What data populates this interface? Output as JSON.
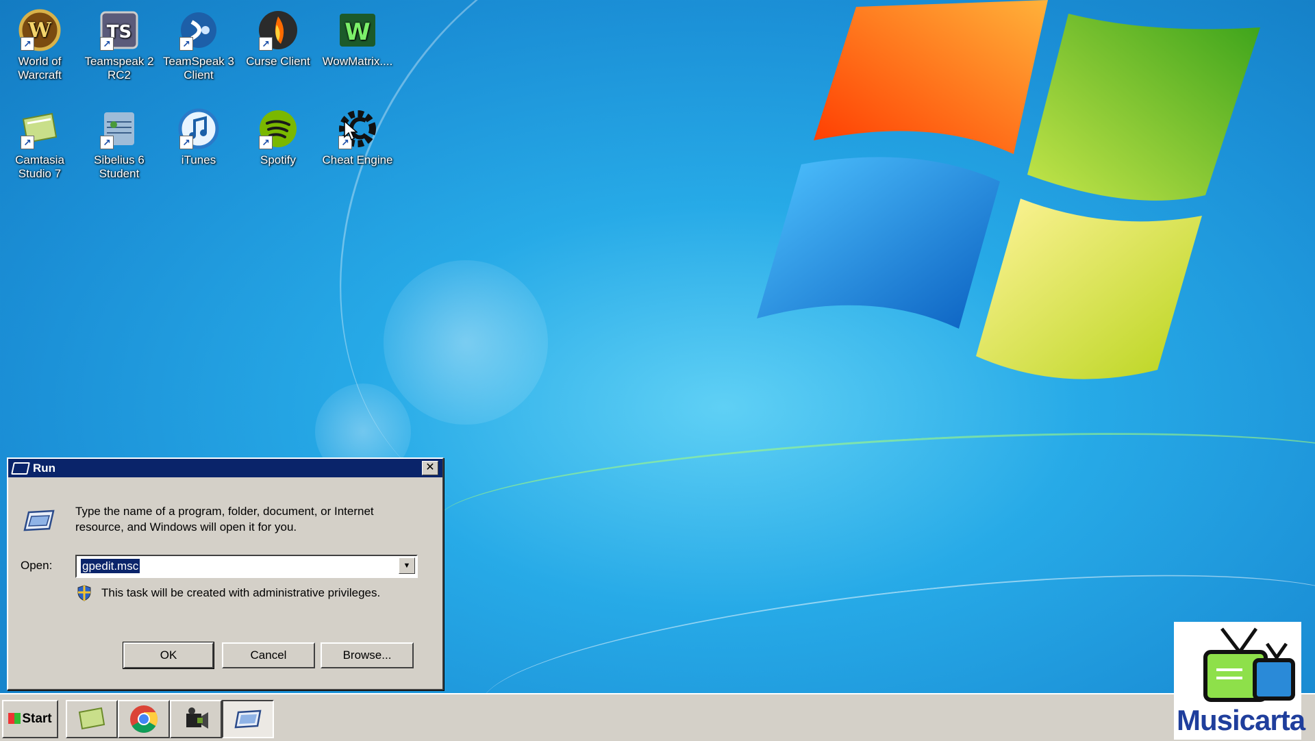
{
  "desktop_icons": [
    {
      "label": "World of Warcraft",
      "icon": "world-of-warcraft-icon"
    },
    {
      "label": "Teamspeak 2 RC2",
      "icon": "teamspeak-2-icon"
    },
    {
      "label": "TeamSpeak 3 Client",
      "icon": "teamspeak-3-icon"
    },
    {
      "label": "Curse Client",
      "icon": "curse-client-icon"
    },
    {
      "label": "WowMatrix....",
      "icon": "wowmatrix-icon"
    },
    {
      "label": "Camtasia Studio 7",
      "icon": "camtasia-icon"
    },
    {
      "label": "Sibelius 6 Student",
      "icon": "sibelius-icon"
    },
    {
      "label": "iTunes",
      "icon": "itunes-icon"
    },
    {
      "label": "Spotify",
      "icon": "spotify-icon"
    },
    {
      "label": "Cheat Engine",
      "icon": "cheat-engine-icon"
    }
  ],
  "run_dialog": {
    "title": "Run",
    "close_glyph": "✕",
    "description": "Type the name of a program, folder, document, or Internet resource, and Windows will open it for you.",
    "open_label": "Open:",
    "open_value": "gpedit.msc",
    "admin_note": "This task will be created with administrative privileges.",
    "ok_label": "OK",
    "cancel_label": "Cancel",
    "browse_label": "Browse..."
  },
  "taskbar": {
    "start_label": "Start",
    "buttons": [
      "camtasia-icon",
      "chrome-icon",
      "video-camera-icon",
      "run-icon"
    ]
  },
  "watermark": {
    "text": "Musicarta"
  },
  "colors": {
    "title_bar": "#0a246a",
    "dialog_face": "#d4d0c8",
    "desktop_blue": "#27aae7"
  }
}
